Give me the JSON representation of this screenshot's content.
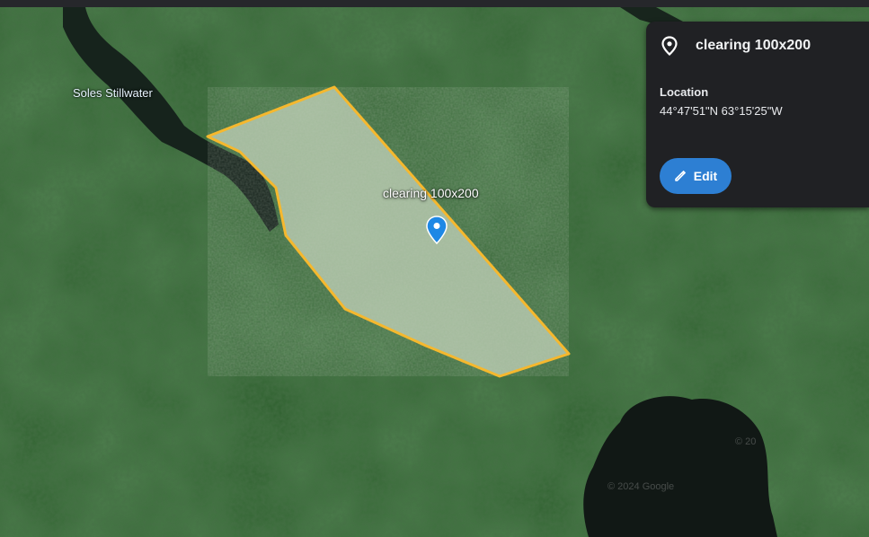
{
  "map": {
    "place_label": "Soles Stillwater",
    "polygon_label": "clearing 100x200",
    "watermark_copyright": "© 2024 Google",
    "watermark_short": "© 20",
    "colors": {
      "polygon_stroke": "#f5b82e",
      "polygon_fill": "#c9d7c0",
      "pin": "#1e88e5",
      "forest": "#2a5a2a",
      "water": "#121a18"
    }
  },
  "panel": {
    "icon": "location-pin-icon",
    "title": "clearing 100x200",
    "location_label": "Location",
    "location_value": "44°47'51\"N 63°15'25\"W",
    "edit_label": "Edit",
    "edit_icon": "pencil-icon"
  }
}
